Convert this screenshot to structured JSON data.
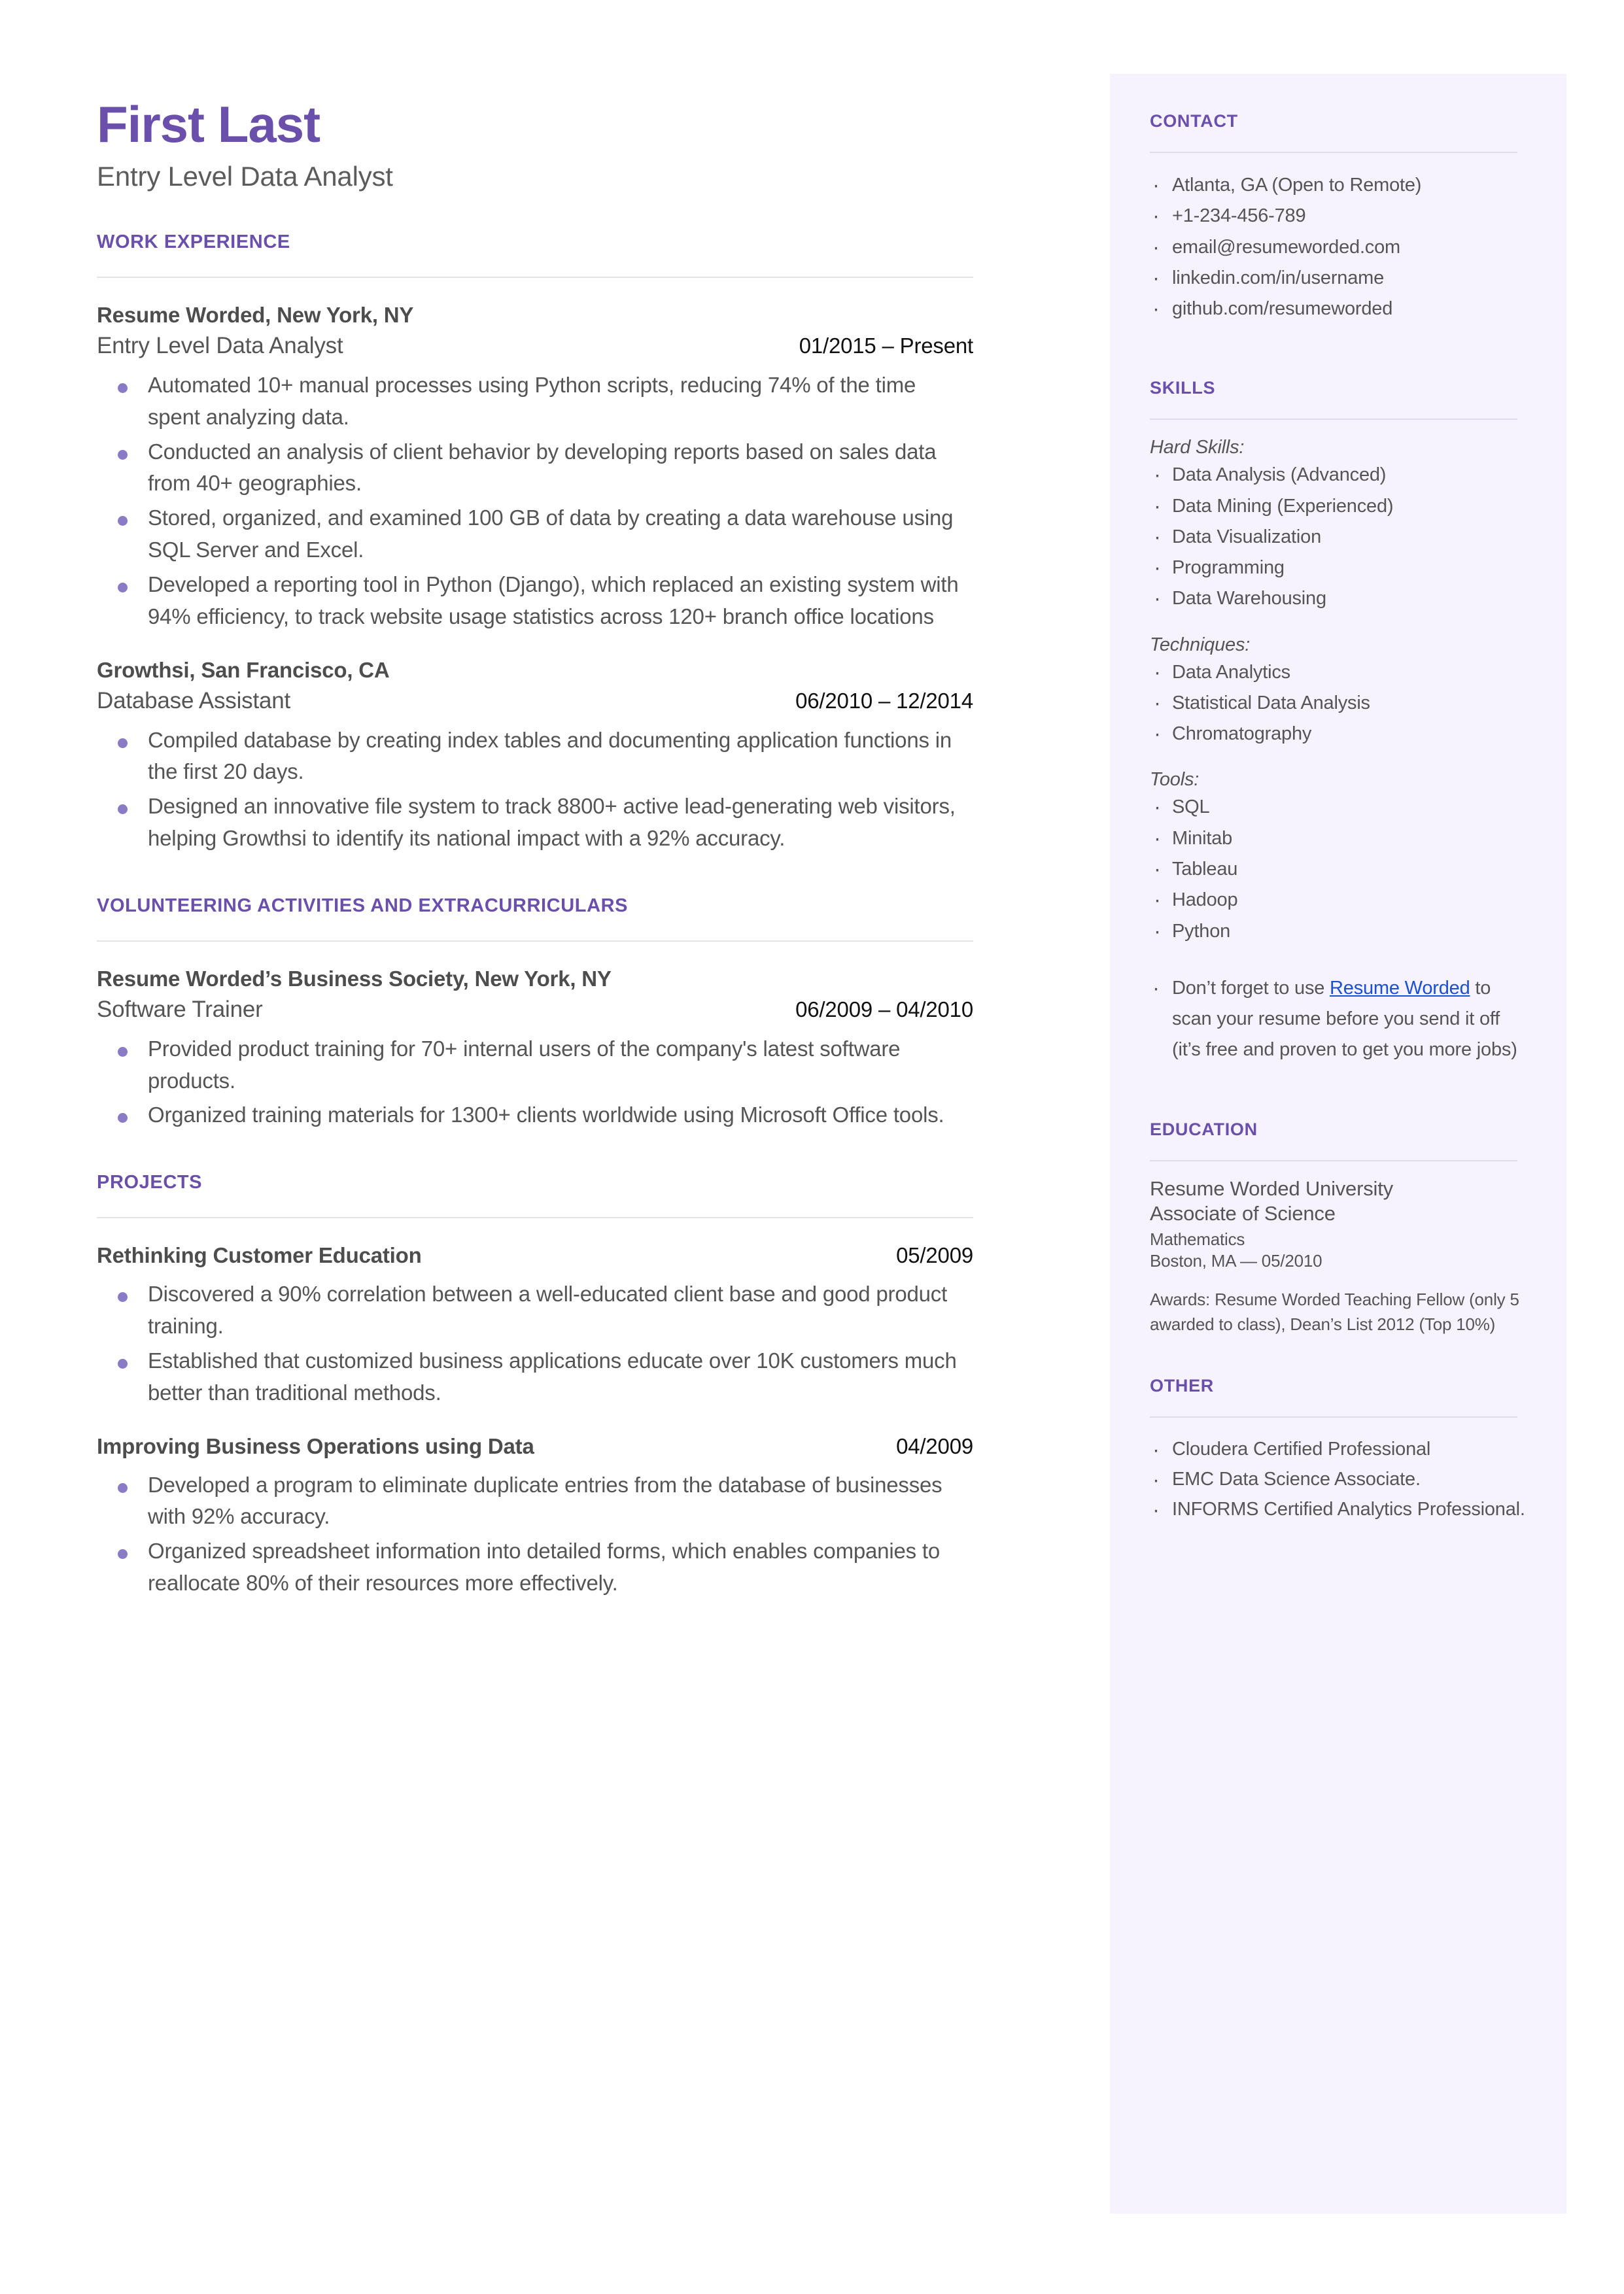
{
  "header": {
    "name": "First Last",
    "headline": "Entry Level Data Analyst"
  },
  "sections": {
    "work_experience": {
      "title": "WORK EXPERIENCE",
      "entries": [
        {
          "org": "Resume Worded, New York, NY",
          "role": "Entry Level Data Analyst",
          "date": "01/2015 – Present",
          "bullets": [
            "Automated 10+ manual processes using Python scripts, reducing 74% of the time spent analyzing data.",
            "Conducted an analysis of client behavior by developing reports based on sales data from 40+ geographies.",
            "Stored, organized, and examined 100 GB of data by creating a data warehouse using SQL Server and Excel.",
            "Developed a reporting tool in Python (Django), which replaced an existing system with 94% efficiency, to track website usage statistics across 120+ branch office locations"
          ]
        },
        {
          "org": "Growthsi, San Francisco, CA",
          "role": "Database Assistant",
          "date": "06/2010 – 12/2014",
          "bullets": [
            "Compiled database by creating index tables and documenting application functions in the first 20 days.",
            "Designed an innovative file system to track 8800+ active lead-generating web visitors, helping Growthsi to identify its national impact with a 92% accuracy."
          ]
        }
      ]
    },
    "volunteering": {
      "title": "VOLUNTEERING ACTIVITIES AND EXTRACURRICULARS",
      "entries": [
        {
          "org": "Resume Worded’s Business Society, New York, NY",
          "role": "Software Trainer",
          "date": "06/2009 – 04/2010",
          "bullets": [
            "Provided product training for 70+ internal users of the company's latest software products.",
            "Organized training materials for 1300+ clients worldwide using Microsoft Office tools."
          ]
        }
      ]
    },
    "projects": {
      "title": "PROJECTS",
      "entries": [
        {
          "org": "Rethinking Customer Education",
          "date": "05/2009",
          "bullets": [
            "Discovered a 90% correlation between a well-educated client base and good product training.",
            "Established that customized business applications educate over 10K customers much better than traditional methods."
          ]
        },
        {
          "org": "Improving Business Operations using Data",
          "date": "04/2009",
          "bullets": [
            "Developed a program to eliminate duplicate entries from the database of businesses with 92% accuracy.",
            "Organized spreadsheet information into detailed forms, which enables companies to reallocate 80% of their resources more effectively."
          ]
        }
      ]
    }
  },
  "sidebar": {
    "contact": {
      "title": "CONTACT",
      "items": [
        "Atlanta, GA (Open to Remote)",
        "+1-234-456-789",
        "email@resumeworded.com",
        "linkedin.com/in/username",
        "github.com/resumeworded"
      ]
    },
    "skills": {
      "title": "SKILLS",
      "groups": [
        {
          "label": "Hard Skills:",
          "items": [
            "Data Analysis (Advanced)",
            "Data Mining (Experienced)",
            "Data Visualization",
            "Programming",
            "Data Warehousing"
          ]
        },
        {
          "label": "Techniques:",
          "items": [
            "Data Analytics",
            "Statistical Data Analysis",
            "Chromatography"
          ]
        },
        {
          "label": "Tools:",
          "items": [
            "SQL",
            "Minitab",
            "Tableau",
            "Hadoop",
            "Python"
          ]
        }
      ],
      "promo": {
        "before": "Don’t forget to use ",
        "link": "Resume Worded",
        "after": " to scan your resume before you send it off (it’s free and proven to get you more jobs)"
      }
    },
    "education": {
      "title": "EDUCATION",
      "school": "Resume Worded University",
      "degree": "Associate of Science",
      "field": "Mathematics",
      "location_date": "Boston, MA — 05/2010",
      "awards": "Awards: Resume Worded Teaching Fellow (only 5 awarded to class), Dean’s List 2012 (Top 10%)"
    },
    "other": {
      "title": "OTHER",
      "items": [
        "Cloudera Certified Professional",
        " EMC Data Science Associate.",
        "INFORMS Certified Analytics Professional."
      ]
    }
  },
  "colors": {
    "accent_purple": "#6a4fab",
    "bullet_purple": "#8b7bc7",
    "sidebar_bg": "#f6f2fe",
    "body_text": "#555555",
    "link_blue": "#1a4fd6"
  }
}
